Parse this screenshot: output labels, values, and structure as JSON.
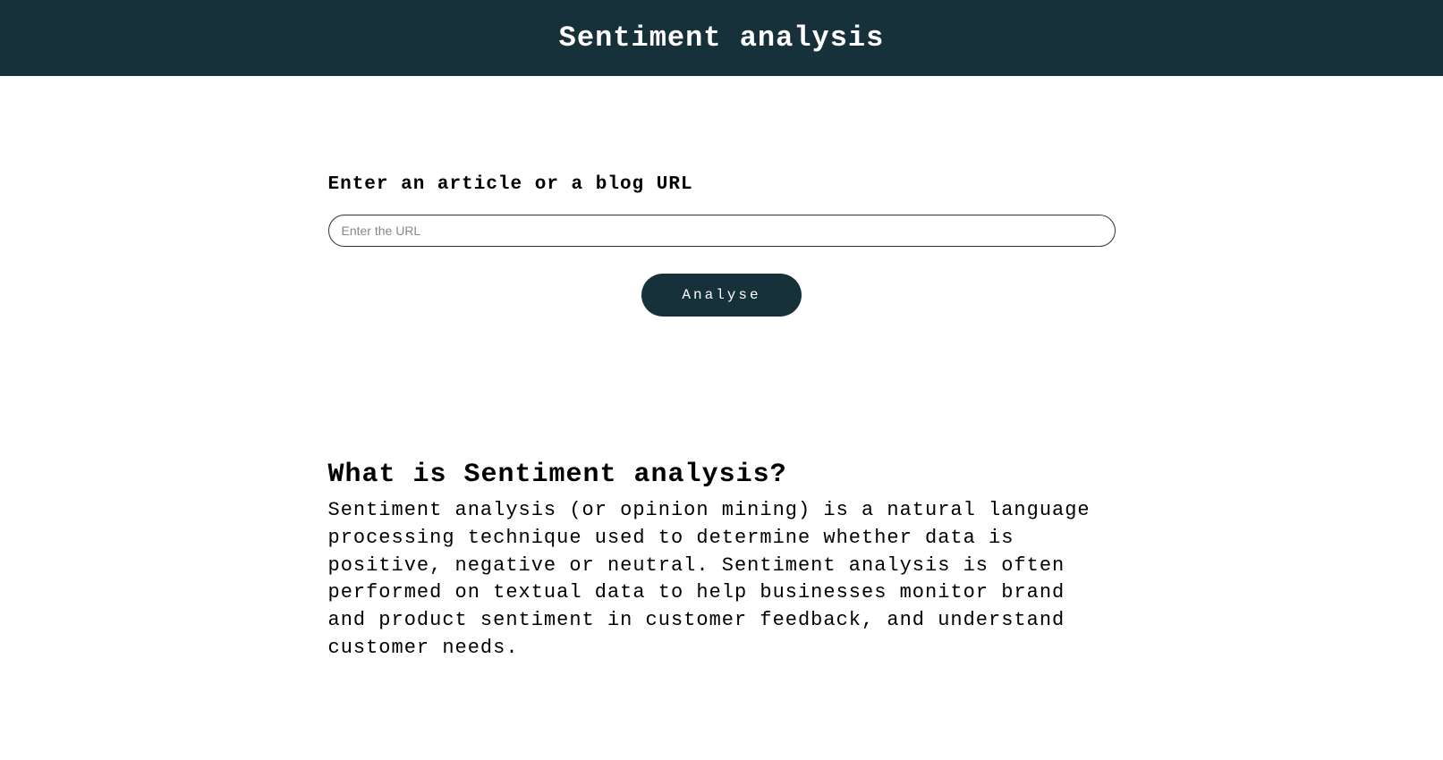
{
  "header": {
    "title": "Sentiment analysis"
  },
  "form": {
    "label": "Enter an article or a blog URL",
    "placeholder": "Enter the URL",
    "button_label": "Analyse"
  },
  "info": {
    "heading": "What is Sentiment analysis?",
    "body": "Sentiment analysis (or opinion mining) is a natural language processing technique used to determine whether data is positive, negative or neutral. Sentiment analysis is often performed on textual data to help businesses monitor brand and product sentiment in customer feedback, and understand customer needs."
  }
}
